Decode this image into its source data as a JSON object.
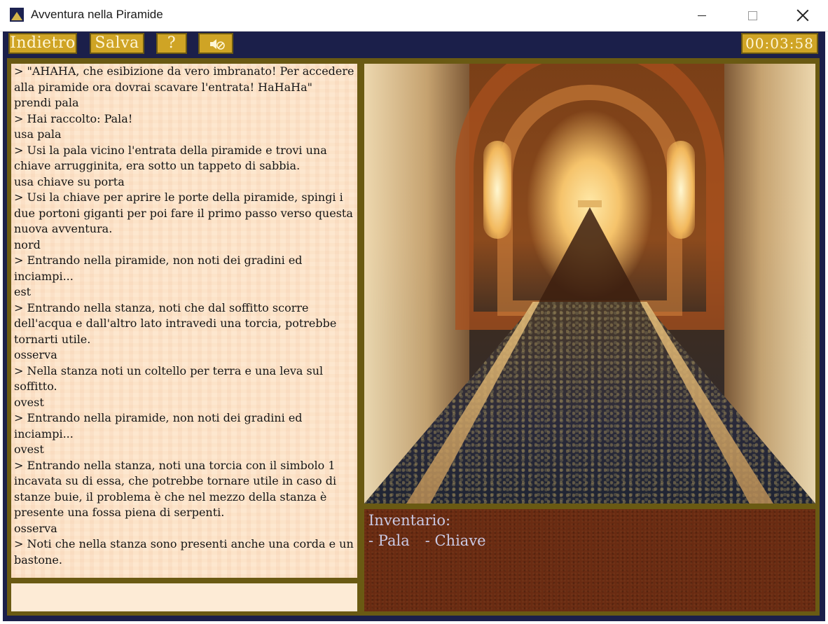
{
  "window": {
    "title": "Avventura nella Piramide"
  },
  "toolbar": {
    "back_label": "Indietro",
    "save_label": "Salva",
    "help_label": "?",
    "sound_icon": "speaker-muted-icon",
    "timer": "00:03:58"
  },
  "log": {
    "lines": [
      "> \"AHAHA, che esibizione da vero imbranato! Per accedere alla piramide ora dovrai scavare l'entrata! HaHaHa\"",
      "prendi pala",
      "> Hai raccolto: Pala!",
      "usa pala",
      "> Usi la pala vicino l'entrata della piramide e trovi una chiave arrugginita, era sotto un tappeto di sabbia.",
      "usa chiave su porta",
      "> Usi la chiave per aprire le porte della piramide, spingi i due portoni giganti per poi fare il primo passo verso questa nuova avventura.",
      "nord",
      "> Entrando nella piramide, non noti dei gradini ed inciampi...",
      "est",
      "> Entrando nella stanza, noti che dal soffitto scorre dell'acqua e dall'altro lato intravedi una torcia, potrebbe tornarti utile.",
      "osserva",
      "> Nella stanza noti un coltello per terra e una leva sul soffitto.",
      "ovest",
      "> Entrando nella piramide, non noti dei gradini ed inciampi...",
      "ovest",
      "> Entrando nella stanza, noti una torcia con il simbolo 1 incavata su di essa, che potrebbe tornare utile in caso di stanze buie, il problema è che nel mezzo della stanza è presente una fossa piena di serpenti.",
      "osserva",
      "> Noti che nella stanza sono presenti anche una corda e un bastone."
    ],
    "input_value": ""
  },
  "inventory": {
    "title": "Inventario:",
    "items": [
      "- Pala",
      "- Chiave"
    ]
  },
  "colors": {
    "app_background": "#1b1f4a",
    "button_gold": "#cfa425",
    "frame_olive": "#6a5a13",
    "parchment": "#fde7cf",
    "inventory_brown": "#6a2b12",
    "inventory_text": "#c9c9e4"
  }
}
